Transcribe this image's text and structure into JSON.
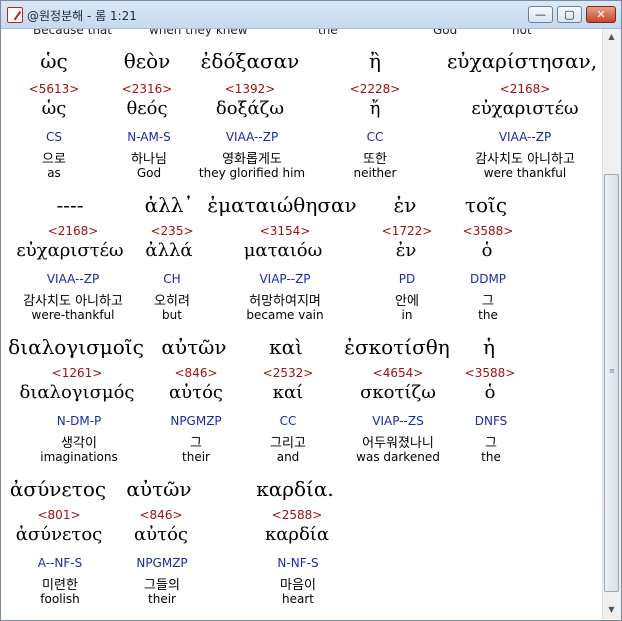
{
  "window": {
    "title": "@원정분해 - 롬 1:21",
    "buttons": {
      "minimize": "—",
      "maximize": "▢",
      "close": "✕"
    }
  },
  "top_cut": [
    "Because that",
    "when they knew",
    "the",
    "God",
    "not"
  ],
  "blocks": [
    {
      "words": [
        {
          "gk": "ὡς",
          "num": "<5613>",
          "lem": "ὡς",
          "morph": "CS",
          "kor": "으로",
          "eng": "as"
        },
        {
          "gk": "θεὸν",
          "num": "<2316>",
          "lem": "θεός",
          "morph": "N-AM-S",
          "kor": "하나님",
          "eng": "God"
        },
        {
          "gk": "ἐδόξασαν",
          "num": "<1392>",
          "lem": "δοξάζω",
          "morph": "VIAA--ZP",
          "kor": "영화롭게도",
          "eng": "they glorified him"
        },
        {
          "gk": "ἢ",
          "num": "<2228>",
          "lem": "ἤ",
          "morph": "CC",
          "kor": "또한",
          "eng": "neither"
        },
        {
          "gk": "εὐχαρίστησαν,",
          "num": "<2168>",
          "lem": "εὐχαριστέω",
          "morph": "VIAA--ZP",
          "kor": "감사치도 아니하고",
          "eng": "were thankful"
        }
      ]
    },
    {
      "words": [
        {
          "gk": "----",
          "num": "<2168>",
          "lem": "εὐχαριστέω",
          "morph": "VIAA--ZP",
          "kor": "감사치도 아니하고",
          "eng": "were-thankful"
        },
        {
          "gk": "ἀλλ᾽",
          "num": "<235>",
          "lem": "ἀλλά",
          "morph": "CH",
          "kor": "오히려",
          "eng": "but"
        },
        {
          "gk": "ἐματαιώθησαν",
          "num": "<3154>",
          "lem": "ματαιόω",
          "morph": "VIAP--ZP",
          "kor": "허망하여지며",
          "eng": "became vain"
        },
        {
          "gk": "ἐν",
          "num": "<1722>",
          "lem": "ἐν",
          "morph": "PD",
          "kor": "안에",
          "eng": "in"
        },
        {
          "gk": "τοῖς",
          "num": "<3588>",
          "lem": "ὁ",
          "morph": "DDMP",
          "kor": "그",
          "eng": "the"
        }
      ]
    },
    {
      "words": [
        {
          "gk": "διαλογισμοῖς",
          "num": "<1261>",
          "lem": "διαλογισμός",
          "morph": "N-DM-P",
          "kor": "생각이",
          "eng": "imaginations"
        },
        {
          "gk": "αὐτῶν",
          "num": "<846>",
          "lem": "αὐτός",
          "morph": "NPGMZP",
          "kor": "그",
          "eng": "their"
        },
        {
          "gk": "καὶ",
          "num": "<2532>",
          "lem": "καί",
          "morph": "CC",
          "kor": "그리고",
          "eng": "and"
        },
        {
          "gk": "ἐσκοτίσθη",
          "num": "<4654>",
          "lem": "σκοτίζω",
          "morph": "VIAP--ZS",
          "kor": "어두워졌나니",
          "eng": "was darkened"
        },
        {
          "gk": "ἡ",
          "num": "<3588>",
          "lem": "ὁ",
          "morph": "DNFS",
          "kor": "그",
          "eng": "the"
        }
      ]
    },
    {
      "words": [
        {
          "gk": "ἀσύνετος",
          "num": "<801>",
          "lem": "ἀσύνετος",
          "morph": "A--NF-S",
          "kor": "미련한",
          "eng": "foolish"
        },
        {
          "gk": "αὐτῶν",
          "num": "<846>",
          "lem": "αὐτός",
          "morph": "NPGMZP",
          "kor": "그들의",
          "eng": "their"
        },
        {
          "gk": "καρδία.",
          "num": "<2588>",
          "lem": "καρδία",
          "morph": "N-NF-S",
          "kor": "마음이",
          "eng": "heart"
        }
      ]
    }
  ]
}
